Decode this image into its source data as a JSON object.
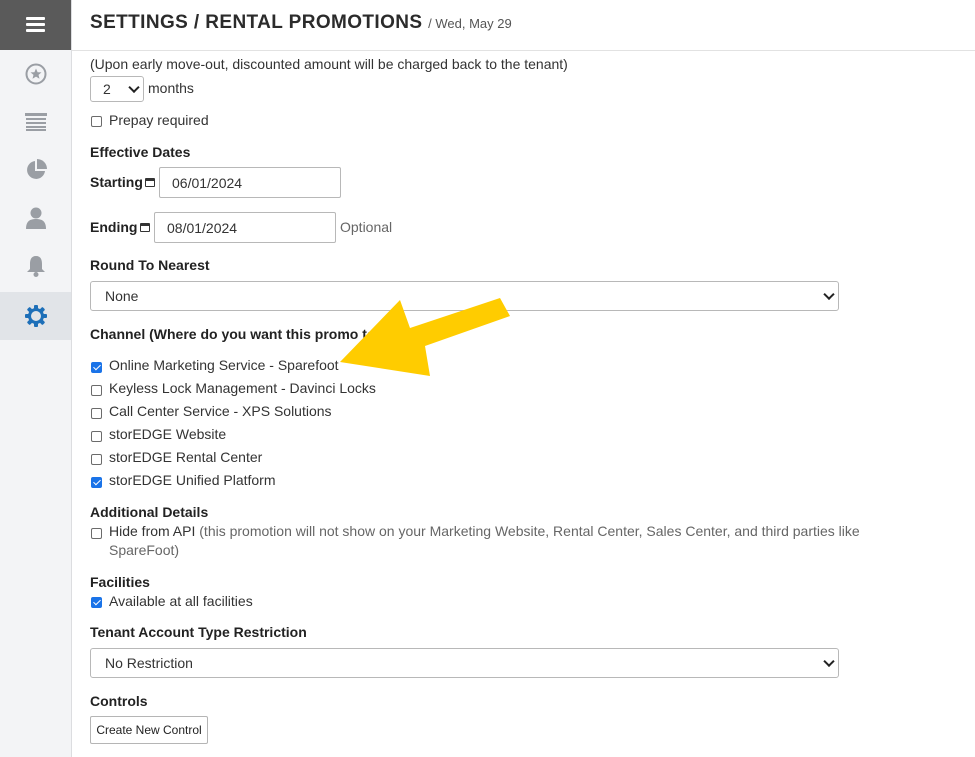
{
  "header": {
    "title": "SETTINGS / RENTAL PROMOTIONS",
    "date": "/ Wed, May 29"
  },
  "sidebar": {
    "items": [
      {
        "icon": "star-icon"
      },
      {
        "icon": "list-icon"
      },
      {
        "icon": "pie-chart-icon"
      },
      {
        "icon": "user-icon"
      },
      {
        "icon": "bell-icon"
      },
      {
        "icon": "gear-icon",
        "active": true
      }
    ]
  },
  "form": {
    "early_moveout_note": "(Upon early move-out, discounted amount will be charged back to the tenant)",
    "months_value": "2",
    "months_label": "months",
    "prepay_label": "Prepay required",
    "prepay_checked": false,
    "effective_dates_label": "Effective Dates",
    "starting_label": "Starting",
    "starting_value": "06/01/2024",
    "ending_label": "Ending",
    "ending_value": "08/01/2024",
    "ending_hint": "Optional",
    "round_label": "Round To Nearest",
    "round_value": "None",
    "channel_label": "Channel (Where do you want this promo to di",
    "channels": [
      {
        "label": "Online Marketing Service - Sparefoot",
        "checked": true
      },
      {
        "label": "Keyless Lock Management - Davinci Locks",
        "checked": false
      },
      {
        "label": "Call Center Service - XPS Solutions",
        "checked": false
      },
      {
        "label": "storEDGE Website",
        "checked": false
      },
      {
        "label": "storEDGE Rental Center",
        "checked": false
      },
      {
        "label": "storEDGE Unified Platform",
        "checked": true
      }
    ],
    "additional_details_label": "Additional Details",
    "hide_api_label": "Hide from API",
    "hide_api_note_line1": "(this promotion will not show on your Marketing Website, Rental Center, Sales Center, and third parties like",
    "hide_api_note_line2": "SpareFoot)",
    "hide_api_checked": false,
    "facilities_label": "Facilities",
    "all_facilities_label": "Available at all facilities",
    "all_facilities_checked": true,
    "tenant_type_label": "Tenant Account Type Restriction",
    "tenant_type_value": "No Restriction",
    "controls_label": "Controls",
    "create_control_label": "Create New Control"
  },
  "annotation": {
    "arrow_color": "#ffcc00"
  }
}
